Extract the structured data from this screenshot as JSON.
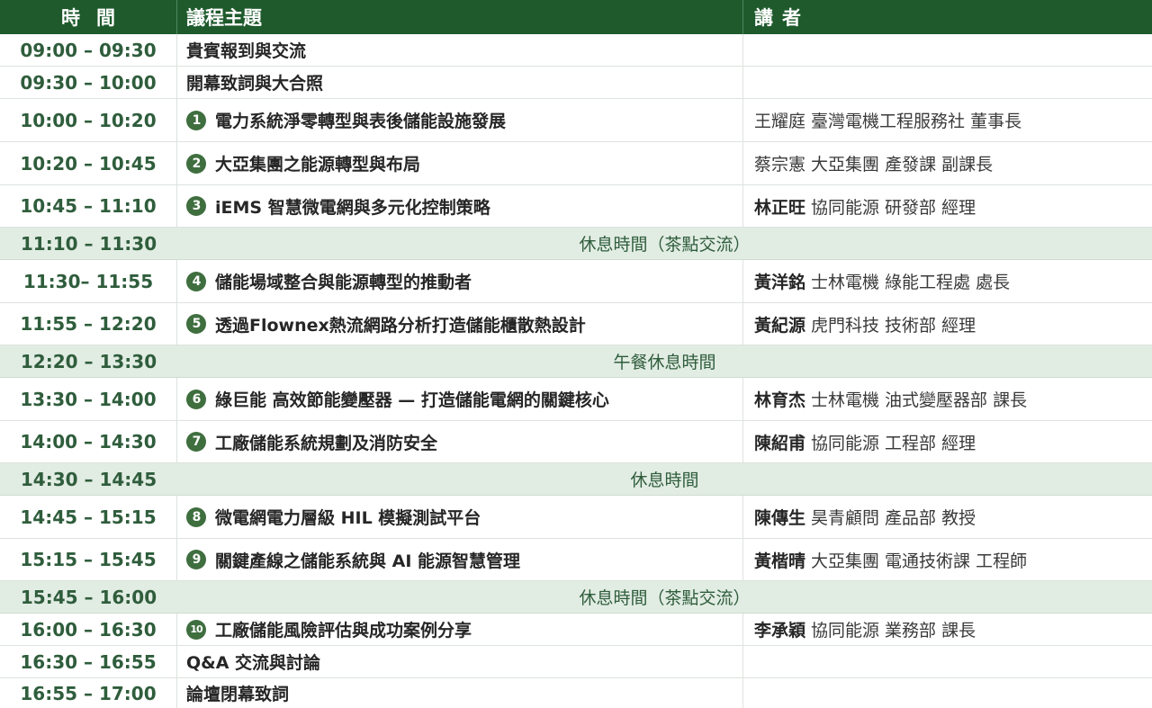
{
  "header": {
    "time": "時間",
    "topic": "議程主題",
    "speaker": "講者"
  },
  "colors": {
    "header_bg": "#1e5a2c",
    "break_bg": "#e1ece3",
    "time_text": "#2f5d3c",
    "badge": "#3f6e3f"
  },
  "rows": [
    {
      "time": "09:00 – 09:30",
      "topic": "貴賓報到與交流",
      "badge": "",
      "name": "",
      "org": ""
    },
    {
      "time": "09:30 – 10:00",
      "topic": "開幕致詞與大合照",
      "badge": "",
      "name": "",
      "org": ""
    },
    {
      "time": "10:00 – 10:20",
      "topic": "電力系統淨零轉型與表後儲能設施發展",
      "badge": "1",
      "name": "",
      "org": "王耀庭 臺灣電機工程服務社  董事長"
    },
    {
      "time": "10:20 – 10:45",
      "topic": "大亞集團之能源轉型與布局",
      "badge": "2",
      "name": "",
      "org": "蔡宗憲 大亞集團   產發課   副課長"
    },
    {
      "time": "10:45 – 11:10",
      "topic": "iEMS 智慧微電網與多元化控制策略",
      "badge": "3",
      "name": "林正旺",
      "org": "協同能源   研發部   經理"
    },
    {
      "time": "11:10 – 11:30",
      "break": "休息時間（茶點交流）"
    },
    {
      "time": "11:30– 11:55",
      "topic": "儲能場域整合與能源轉型的推動者",
      "badge": "4",
      "name": "黃洋銘",
      "org": "士林電機   綠能工程處   處長"
    },
    {
      "time": "11:55 – 12:20",
      "topic": "透過Flownex熱流網路分析打造儲能櫃散熱設計",
      "badge": "5",
      "name": "黃紀源",
      "org": "虎門科技   技術部   經理"
    },
    {
      "time": "12:20 – 13:30",
      "break": "午餐休息時間"
    },
    {
      "time": "13:30 – 14:00",
      "topic": "綠巨能 高效節能變壓器 — 打造儲能電網的關鍵核心",
      "badge": "6",
      "name": "林育杰",
      "org": "士林電機   油式變壓器部   課長"
    },
    {
      "time": "14:00 – 14:30",
      "topic": "工廠儲能系統規劃及消防安全",
      "badge": "7",
      "name": "陳紹甫",
      "org": "協同能源   工程部   經理"
    },
    {
      "time": "14:30 – 14:45",
      "break": "休息時間"
    },
    {
      "time": "14:45 – 15:15",
      "topic": "微電網電力層級 HIL 模擬測試平台",
      "badge": "8",
      "name": "陳傳生",
      "org": "昊青顧問   產品部   教授"
    },
    {
      "time": "15:15 – 15:45",
      "topic": "關鍵產線之儲能系統與 AI 能源智慧管理",
      "badge": "9",
      "name": "黃楷晴",
      "org": "大亞集團   電通技術課   工程師"
    },
    {
      "time": "15:45 – 16:00",
      "break": "休息時間（茶點交流）"
    },
    {
      "time": "16:00 – 16:30",
      "topic": "工廠儲能風險評估與成功案例分享",
      "badge": "10",
      "name": "李承穎",
      "org": "協同能源   業務部   課長"
    },
    {
      "time": "16:30 – 16:55",
      "topic": "Q&A 交流與討論",
      "badge": "",
      "name": "",
      "org": ""
    },
    {
      "time": "16:55 – 17:00",
      "topic": "論壇閉幕致詞",
      "badge": "",
      "name": "",
      "org": ""
    }
  ]
}
